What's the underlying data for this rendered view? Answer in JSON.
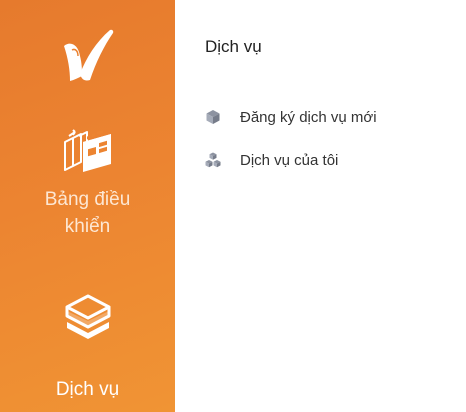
{
  "sidebar": {
    "logo_icon": "checkmark-logo",
    "items": [
      {
        "label": "Bảng điều khiển",
        "icon": "dashboard-windows-icon"
      },
      {
        "label": "Dịch vụ",
        "icon": "stacked-box-icon",
        "active": true
      }
    ],
    "colors": {
      "gradient_start": "#e67a2d",
      "gradient_end": "#f09434"
    }
  },
  "main": {
    "title": "Dịch vụ",
    "menu": [
      {
        "label": "Đăng ký dịch vụ mới",
        "icon": "cube-icon"
      },
      {
        "label": "Dịch vụ của tôi",
        "icon": "cubes-icon"
      }
    ]
  }
}
